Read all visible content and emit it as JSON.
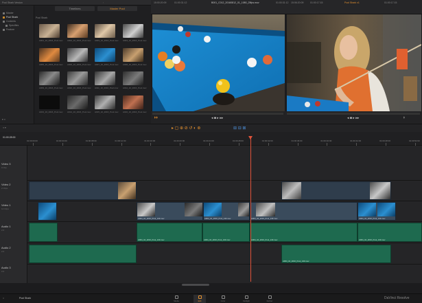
{
  "app": {
    "window_title": "Pool Shark Version",
    "product": "DaVinci Resolve",
    "project_name": "Pool Shark"
  },
  "media_pool": {
    "tabs": [
      "Timelines",
      "Master Pool"
    ],
    "active_tab": 1,
    "folder_header": "Pool Shark",
    "nav_items": [
      {
        "label": "Master",
        "active": false
      },
      {
        "label": "Pool Shark",
        "active": true
      },
      {
        "label": "Contents",
        "active": false
      },
      {
        "label": "Specifies",
        "active": false
      },
      {
        "label": "Feature",
        "active": false
      }
    ],
    "clips": [
      "A001_10_2016_Pool.mov",
      "A002_10_2016_Pool.mov",
      "A003_10_2016_Pool.mov",
      "A004_10_2016_Pool.mov",
      "A005_10_2016_Pool.mov",
      "A006_10_2016_Pool.mov",
      "A007_10_2016_Pool.mov",
      "A008_10_2016_Pool.mov",
      "A009_10_2016_Pool.mov",
      "A010_10_2016_Pool.mov",
      "A011_10_2016_Pool.mov",
      "A012_10_2016_Pool.mov",
      "A013_10_2016_Pool.mov",
      "A014_10_2016_Pool.mov",
      "A015_10_2016_Pool.mov",
      "A016_10_2016_Pool.mov"
    ]
  },
  "viewer": {
    "source_timecode": "01:00:31:12",
    "source_clip": "B001_C012_20160812_01_1080_25fps.mov",
    "source_zoom": "15:00:20:09",
    "program_timecode": "01:00:17:15",
    "program_name": "Pool Shark v1",
    "program_zoom": "15:06:20:09"
  },
  "timeline": {
    "timecode": "01:00:28:00",
    "ruler_ticks": [
      "01:00:00:00",
      "01:00:04:00",
      "01:00:08:00",
      "01:00:12:00",
      "01:00:16:00",
      "01:00:20:00",
      "01:00:24:00",
      "01:00:28:00",
      "01:00:32:00",
      "01:00:36:00",
      "01:00:40:00",
      "01:00:44:00",
      "01:00:48:00",
      "01:00:52:00"
    ],
    "tracks": [
      {
        "name": "Video 3",
        "sub": "0 Clip"
      },
      {
        "name": "Video 2",
        "sub": "2 Clips"
      },
      {
        "name": "Video 1",
        "sub": "14 Clips"
      },
      {
        "name": "Audio 1",
        "sub": "2.0"
      },
      {
        "name": "Audio 2",
        "sub": "2.0"
      },
      {
        "name": "Audio 3",
        "sub": "2.0"
      }
    ],
    "clip_label": "A004_10_2016_Pool_140.mov"
  },
  "pages": [
    "Media",
    "Edit",
    "Color",
    "Fairlight",
    "Deliver"
  ],
  "active_page": 1,
  "branding": "DaVinci Resolve",
  "accent_color": "#e5912f",
  "playhead_color": "#e0533a"
}
